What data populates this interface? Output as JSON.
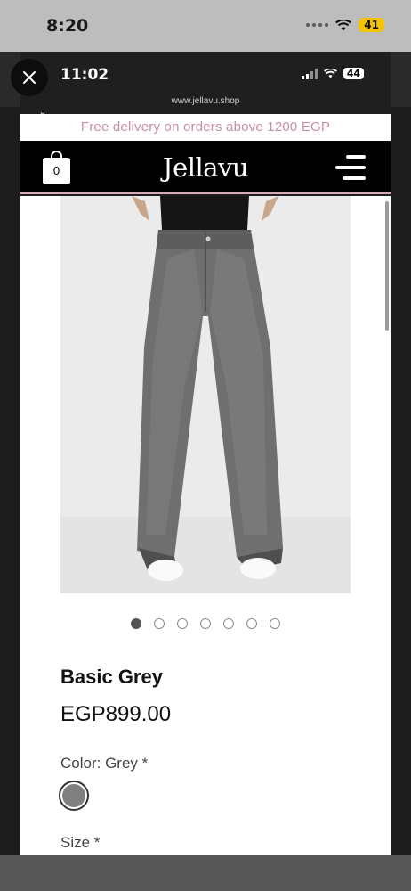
{
  "outer_status": {
    "time": "8:20",
    "battery": "41"
  },
  "inner_status": {
    "time": "11:02",
    "battery": "44"
  },
  "browser": {
    "url": "www.jellavu.shop"
  },
  "promo_banner": "Free delivery on orders above 1200 EGP",
  "header": {
    "logo": "Jellavu",
    "cart_count": "0"
  },
  "product": {
    "name": "Basic Grey",
    "price": "EGP899.00",
    "color_label": "Color: Grey *",
    "selected_color": "#808080",
    "size_label": "Size *",
    "image_count": 7,
    "active_image": 1
  },
  "colors": {
    "brand_pink": "#c98fa1",
    "nav_bg": "#000000"
  }
}
